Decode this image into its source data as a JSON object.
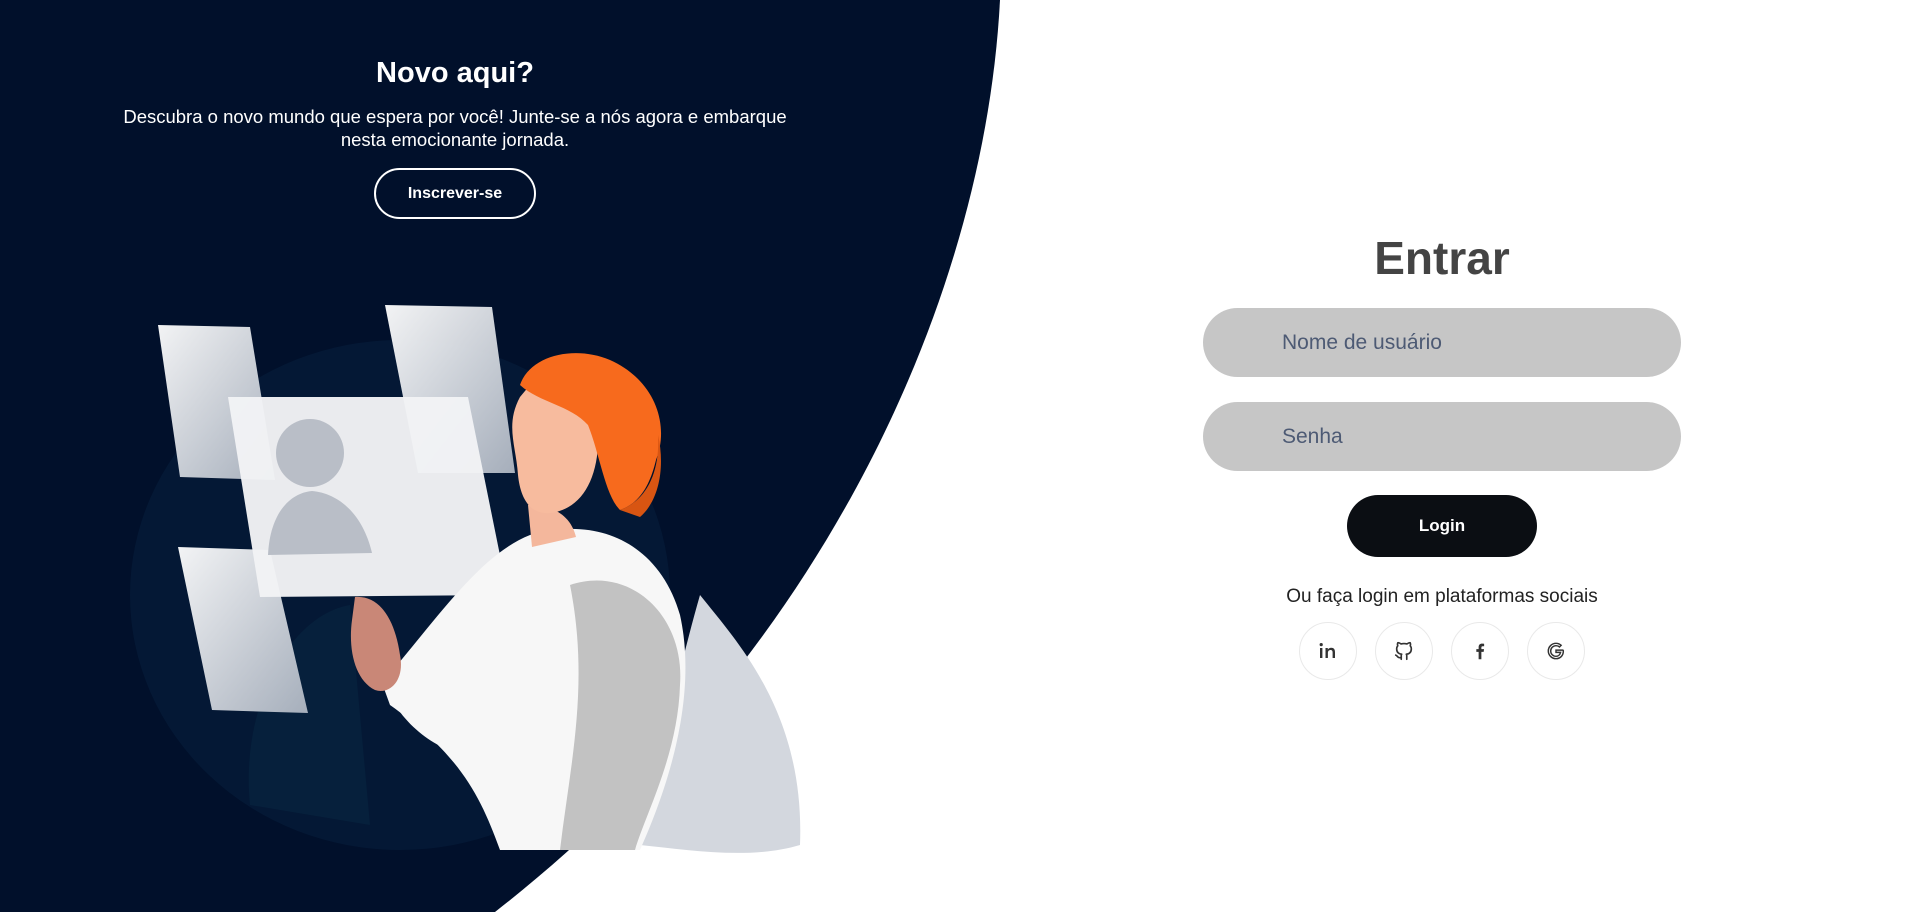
{
  "colors": {
    "panel_bg": "#01102b",
    "page_bg": "#ffffff",
    "input_bg": "#c6c6c6",
    "login_bg": "#0b0e13",
    "hair": "#f76a1d"
  },
  "left_panel": {
    "title": "Novo aqui?",
    "description": "Descubra o novo mundo que espera por você! Junte-se a nós agora e embarque nesta emocionante jornada.",
    "signup_label": "Inscrever-se"
  },
  "form": {
    "title": "Entrar",
    "username_placeholder": "Nome de usuário",
    "password_placeholder": "Senha",
    "login_label": "Login",
    "social_text": "Ou faça login em plataformas sociais",
    "social_icons": [
      "linkedin-icon",
      "github-icon",
      "facebook-icon",
      "google-icon"
    ]
  }
}
